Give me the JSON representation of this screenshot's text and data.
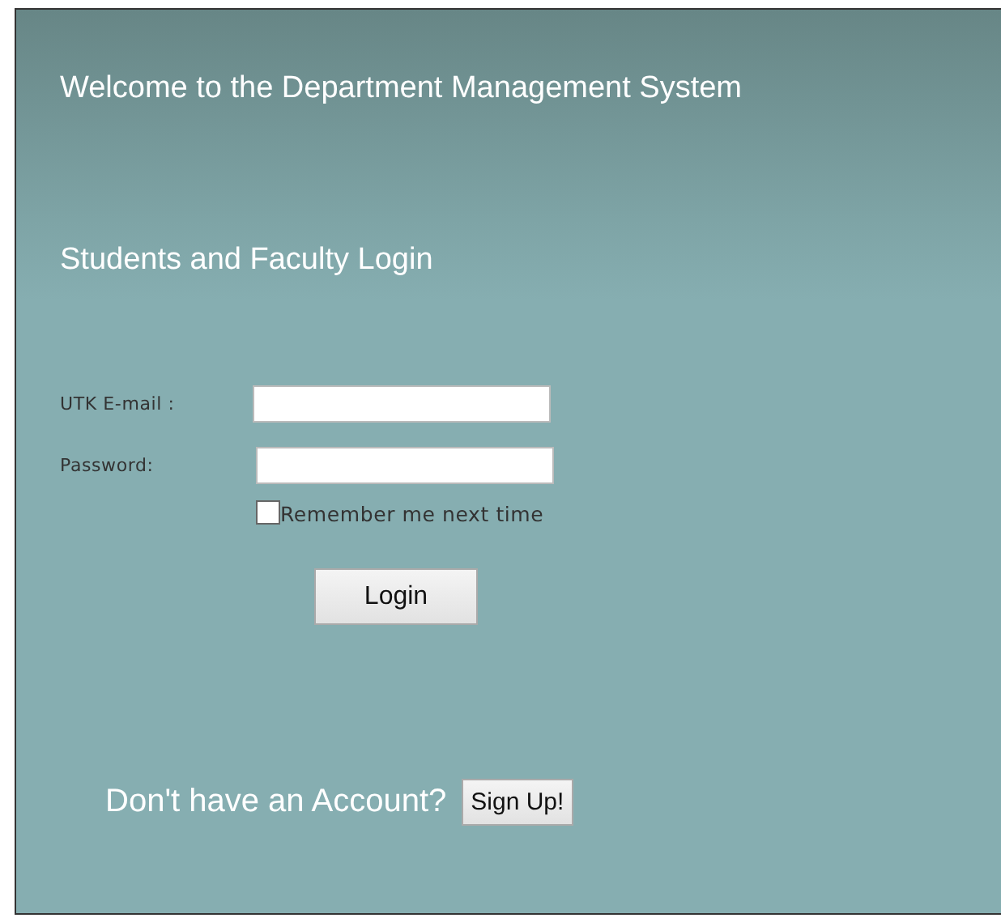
{
  "welcome_title": "Welcome to the Department Management System",
  "login_heading": "Students and Faculty Login",
  "fields": [
    {
      "label": "UTK E-mail :"
    },
    {
      "label": "Password:"
    }
  ],
  "remember": {
    "label": "Remember me next time",
    "checked": false
  },
  "login_button": "Login",
  "signup_prompt": "Don't have an Account?",
  "signup_button": "Sign Up!"
}
